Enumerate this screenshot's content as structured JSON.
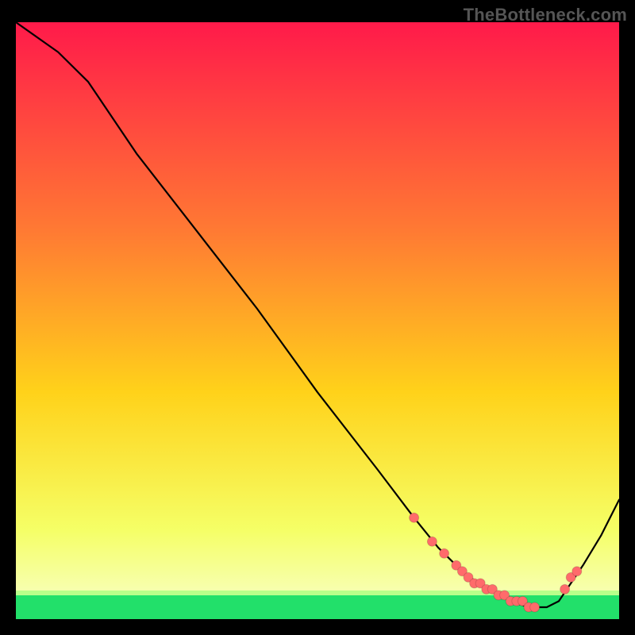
{
  "watermark": "TheBottleneck.com",
  "chart_data": {
    "type": "line",
    "title": "",
    "xlabel": "",
    "ylabel": "",
    "xlim": [
      0,
      100
    ],
    "ylim": [
      0,
      100
    ],
    "background_gradient": {
      "top": "#ff1a4a",
      "mid": "#ffd21a",
      "bottom": "#1aff5a"
    },
    "green_band_top_y": 92,
    "series": [
      {
        "name": "curve",
        "x": [
          0,
          7,
          12,
          20,
          30,
          40,
          50,
          60,
          66,
          70,
          74,
          78,
          82,
          85,
          88,
          90,
          94,
          97,
          100
        ],
        "y": [
          100,
          95,
          90,
          78,
          65,
          52,
          38,
          25,
          17,
          12,
          8,
          5,
          3,
          2,
          2,
          3,
          9,
          14,
          20
        ]
      }
    ],
    "markers": {
      "name": "dots",
      "x": [
        66,
        69,
        71,
        73,
        74,
        75,
        76,
        77,
        78,
        79,
        80,
        81,
        82,
        83,
        84,
        85,
        86,
        91,
        92,
        93
      ],
      "y": [
        17,
        13,
        11,
        9,
        8,
        7,
        6,
        6,
        5,
        5,
        4,
        4,
        3,
        3,
        3,
        2,
        2,
        5,
        7,
        8
      ],
      "color": "#ff6b6b",
      "radius": 6
    }
  }
}
